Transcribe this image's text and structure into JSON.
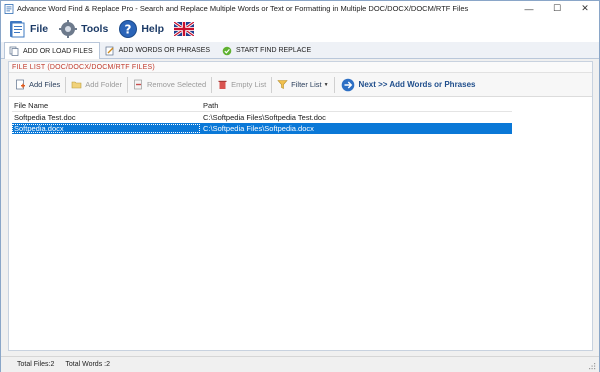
{
  "window": {
    "title": "Advance Word Find & Replace Pro - Search and Replace Multiple Words or Text  or Formatting in Multiple DOC/DOCX/DOCM/RTF Files",
    "controls": {
      "minimize": "—",
      "maximize": "☐",
      "close": "✕"
    }
  },
  "menu": {
    "file": "File",
    "tools": "Tools",
    "help": "Help"
  },
  "tabs": [
    {
      "label": "ADD OR LOAD FILES",
      "active": true
    },
    {
      "label": "ADD WORDS OR PHRASES",
      "active": false
    },
    {
      "label": "START FIND REPLACE",
      "active": false
    }
  ],
  "panel": {
    "header": "FILE LIST (DOC/DOCX/DOCM/RTF FILES)"
  },
  "toolbar": {
    "add_files": "Add Files",
    "add_folder": "Add Folder",
    "remove_selected": "Remove Selected",
    "empty_list": "Empty List",
    "filter_list": "Filter List",
    "next": "Next >> Add Words or Phrases"
  },
  "table": {
    "headers": {
      "name": "File Name",
      "path": "Path"
    },
    "rows": [
      {
        "name": "Softpedia Test.doc",
        "path": "C:\\Softpedia Files\\Softpedia Test.doc",
        "selected": false
      },
      {
        "name": "Softpedia.docx",
        "path": "C:\\Softpedia Files\\Softpedia.docx",
        "selected": true
      }
    ]
  },
  "status": {
    "total_files": "Total Files:2",
    "total_words": "Total Words :2"
  },
  "colors": {
    "selection": "#0a78d7",
    "header_red": "#c0392b",
    "menu_text": "#1b3a66"
  }
}
